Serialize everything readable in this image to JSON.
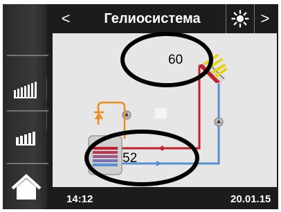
{
  "header": {
    "back_icon": "chevron-left-icon",
    "back_glyph": "<",
    "title": "Гелиосистема",
    "sun_icon": "sun-icon",
    "next_icon": "chevron-right-icon",
    "next_glyph": ">"
  },
  "sidebar": {
    "items": [
      {
        "icon": "bar-levels-tall-icon"
      },
      {
        "icon": "bar-levels-short-icon"
      },
      {
        "icon": "home-icon"
      }
    ]
  },
  "diagram": {
    "collector_temp": "60",
    "tank_temp": "52",
    "colors": {
      "hot_line": "#c0202a",
      "cold_line": "#5a8fd6",
      "tap": "#f08a1a",
      "highlight": "#000000"
    }
  },
  "footer": {
    "time": "14:12",
    "date": "20.01.15"
  }
}
